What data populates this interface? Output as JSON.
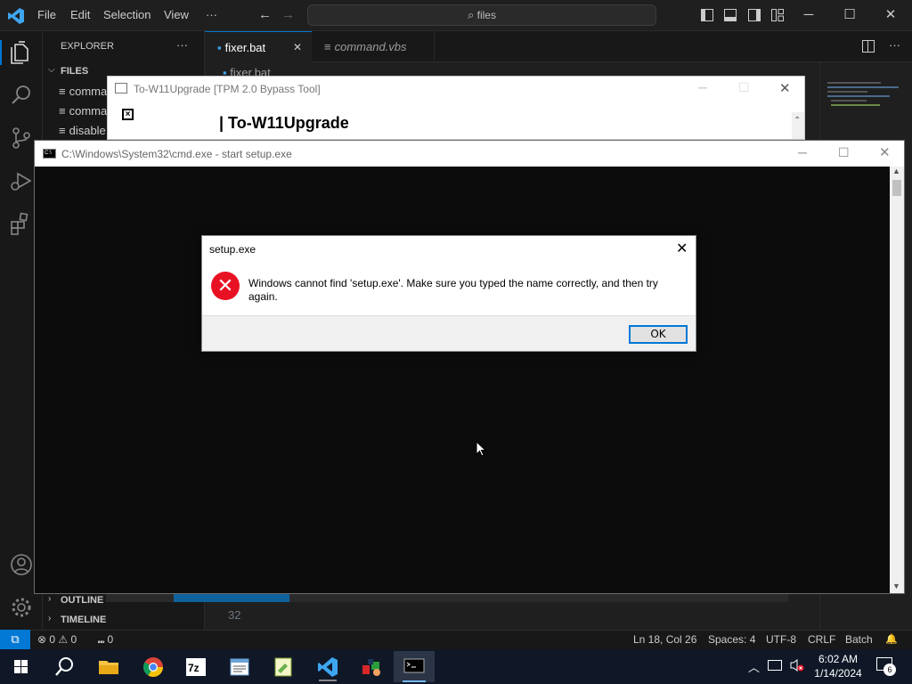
{
  "vscode": {
    "menu": [
      "File",
      "Edit",
      "Selection",
      "View",
      "···"
    ],
    "search_text": "files",
    "sidebar": {
      "title": "EXPLORER",
      "more": "···",
      "section": "FILES",
      "files": [
        "comma",
        "comma",
        "disable"
      ],
      "outline": "OUTLINE",
      "timeline": "TIMELINE"
    },
    "tabs": [
      {
        "label": "fixer.bat",
        "close": "✕"
      },
      {
        "label": "command.vbs"
      }
    ],
    "breadcrumb": "fixer.bat",
    "line_number": "32",
    "status": {
      "remote": "⧉",
      "problems": "⊗ 0 ⚠ 0",
      "ports": "⑉ 0",
      "position": "Ln 18, Col 26",
      "spaces": "Spaces: 4",
      "encoding": "UTF-8",
      "eol": "CRLF",
      "language": "Batch",
      "bell": "🔔"
    },
    "accent": "#0078d4"
  },
  "tool_window": {
    "title": "To-W11Upgrade [TPM 2.0 Bypass Tool]",
    "heading": "| To-W11Upgrade"
  },
  "cmd_window": {
    "title": "C:\\Windows\\System32\\cmd.exe - start  setup.exe"
  },
  "dialog": {
    "title": "setup.exe",
    "message": "Windows cannot find 'setup.exe'. Make sure you typed the name correctly, and then try again.",
    "ok_label": "OK",
    "icon": "error-icon",
    "icon_color": "#e81123"
  },
  "taskbar": {
    "time": "6:02 AM",
    "date": "1/14/2024",
    "notification_count": "6",
    "apps": [
      "start",
      "search",
      "file-explorer",
      "chrome",
      "7zip",
      "notepad",
      "notepad-plus",
      "vscode",
      "games",
      "cmd"
    ]
  }
}
